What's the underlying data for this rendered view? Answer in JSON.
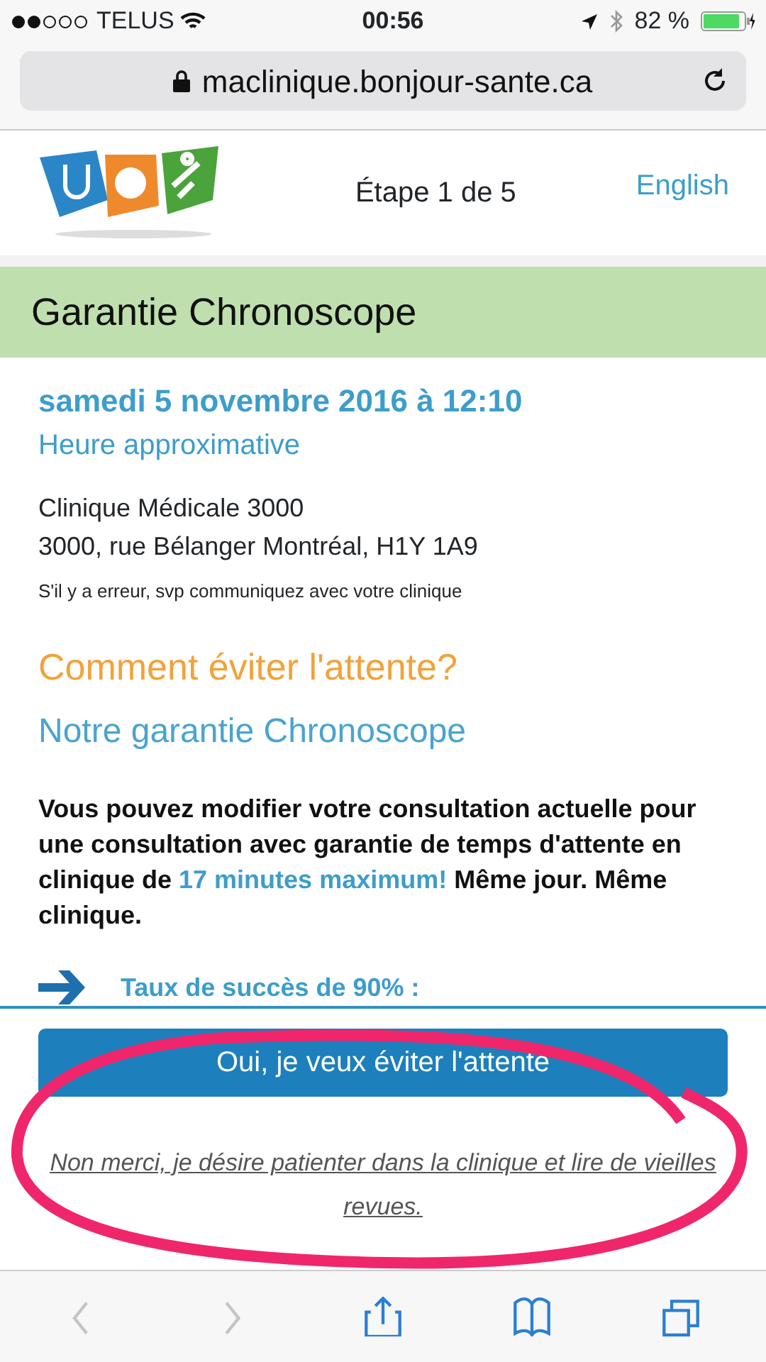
{
  "status_bar": {
    "carrier": "TELUS",
    "time": "00:56",
    "battery": "82 %"
  },
  "address_bar": {
    "url": "maclinique.bonjour-sante.ca"
  },
  "header": {
    "step": "Étape 1 de 5",
    "language_link": "English"
  },
  "banner": {
    "title": "Garantie Chronoscope"
  },
  "appointment": {
    "date": "samedi 5 novembre 2016 à 12:10",
    "note": "Heure approximative",
    "clinic": "Clinique Médicale 3000",
    "address": "3000, rue Bélanger Montréal, H1Y 1A9",
    "error_note": "S'il y a erreur, svp communiquez avec votre clinique"
  },
  "offer": {
    "heading": "Comment éviter l'attente?",
    "subheading": "Notre garantie Chronoscope",
    "paragraph": [
      {
        "text": "Vous pouvez modifier votre consultation actuelle pour une consultation avec garantie de temps d'attente en clinique de ",
        "highlight": false
      },
      {
        "text": "17 minutes maximum!",
        "highlight": true
      },
      {
        "text": " Même jour. Même clinique.",
        "highlight": false
      }
    ],
    "bullet": "Taux de succès de 90% :"
  },
  "actions": {
    "accept_button": "Oui, je veux éviter l'attente",
    "decline_link": "Non merci, je désire patienter dans la clinique et lire de vieilles revues."
  },
  "toolbar": [
    {
      "kind": "back",
      "disabled": true
    },
    {
      "kind": "forward",
      "disabled": true
    },
    {
      "kind": "share",
      "disabled": false
    },
    {
      "kind": "bookmarks",
      "disabled": false
    },
    {
      "kind": "tabs",
      "disabled": false
    }
  ]
}
